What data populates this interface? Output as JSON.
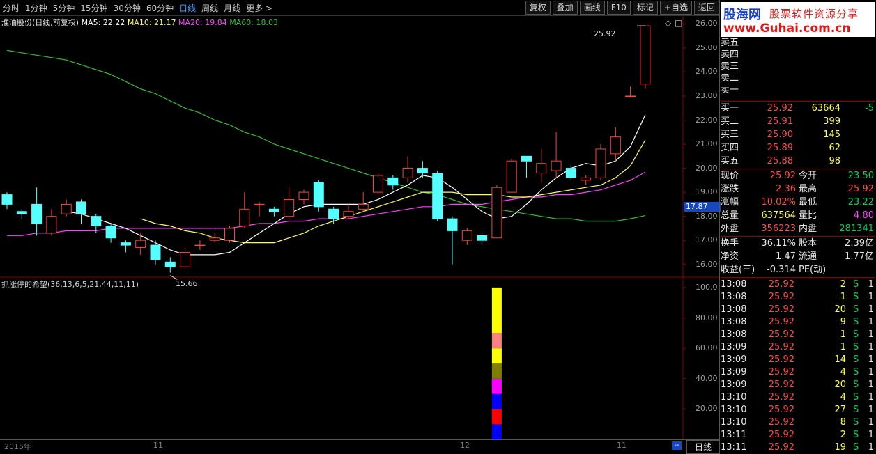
{
  "toolbar": {
    "periods": [
      "分时",
      "1分钟",
      "5分钟",
      "15分钟",
      "30分钟",
      "60分钟",
      "日线",
      "周线",
      "月线",
      "更多 >"
    ],
    "active_index": 6,
    "buttons": [
      "复权",
      "叠加",
      "画线",
      "F10",
      "标记",
      "+自选",
      "返回"
    ]
  },
  "logo": {
    "line1_a": "股海网",
    "line1_b": "股票软件资源分享",
    "line2": "www.Guhai.com.cn"
  },
  "legend": {
    "stock": "淮油股份(日线,前复权)",
    "ma5": "MA5: 22.22",
    "ma10": "MA10: 21.17",
    "ma20": "MA20: 19.84",
    "ma60": "MA60: 18.03"
  },
  "indicator": {
    "name": "抓涨停的希望(36,13,6,5,21,44,11,11)"
  },
  "price_axis": [
    "26.00",
    "25.00",
    "24.00",
    "23.00",
    "22.00",
    "21.00",
    "20.00",
    "19.00",
    "18.00",
    "17.00",
    "16.00"
  ],
  "price_cursor": "17.87",
  "ind_axis": [
    "100.0",
    "80.00",
    "60.00",
    "40.00",
    "20.00"
  ],
  "annotations": {
    "high": "25.92",
    "low": "15.66"
  },
  "time_axis": [
    "2015年",
    "11",
    "12",
    "11"
  ],
  "bottom_period": "日线",
  "colors": {
    "up": "#ff4040",
    "down": "#54ffff",
    "ma5": "#ffffff",
    "ma10": "#ffff50",
    "ma20": "#ff40ff",
    "ma60": "#30c030"
  },
  "chart_data": {
    "type": "candlestick",
    "ylim": [
      15.5,
      26.3
    ],
    "candles": [
      [
        18.9,
        18.5,
        19.0,
        18.3
      ],
      [
        18.2,
        18.1,
        18.3,
        17.9
      ],
      [
        18.5,
        17.7,
        19.2,
        17.2
      ],
      [
        17.3,
        18.0,
        18.3,
        17.2
      ],
      [
        18.1,
        18.5,
        18.7,
        18.0
      ],
      [
        18.6,
        18.1,
        18.7,
        17.7
      ],
      [
        18.0,
        17.6,
        18.1,
        17.3
      ],
      [
        17.6,
        17.1,
        17.7,
        16.9
      ],
      [
        16.9,
        16.8,
        17.0,
        16.5
      ],
      [
        16.7,
        17.0,
        17.3,
        16.4
      ],
      [
        16.8,
        16.2,
        17.0,
        16.0
      ],
      [
        16.1,
        15.9,
        16.3,
        15.66
      ],
      [
        15.9,
        16.5,
        16.7,
        15.8
      ],
      [
        16.8,
        16.8,
        17.0,
        16.6
      ],
      [
        17.0,
        17.1,
        17.3,
        16.9
      ],
      [
        17.0,
        17.5,
        17.6,
        16.9
      ],
      [
        17.6,
        18.3,
        19.0,
        17.5
      ],
      [
        18.5,
        18.5,
        18.6,
        18.0
      ],
      [
        18.3,
        18.2,
        18.4,
        18.0
      ],
      [
        18.0,
        18.7,
        19.2,
        17.9
      ],
      [
        18.7,
        19.0,
        19.1,
        18.5
      ],
      [
        19.4,
        18.4,
        19.5,
        18.2
      ],
      [
        18.3,
        17.9,
        18.4,
        17.7
      ],
      [
        18.0,
        18.2,
        18.5,
        17.9
      ],
      [
        18.3,
        18.5,
        19.0,
        18.2
      ],
      [
        19.0,
        19.7,
        19.8,
        18.9
      ],
      [
        19.6,
        19.3,
        19.7,
        19.1
      ],
      [
        19.6,
        20.0,
        20.5,
        19.4
      ],
      [
        20.0,
        19.8,
        20.3,
        19.6
      ],
      [
        19.8,
        17.9,
        19.9,
        17.8
      ],
      [
        17.9,
        17.4,
        18.0,
        16.0
      ],
      [
        17.0,
        17.4,
        17.5,
        16.8
      ],
      [
        17.2,
        17.0,
        17.3,
        16.8
      ],
      [
        17.1,
        19.2,
        19.3,
        17.1
      ],
      [
        19.0,
        20.3,
        20.4,
        19.0
      ],
      [
        20.5,
        20.3,
        20.5,
        19.6
      ],
      [
        19.8,
        20.2,
        20.8,
        19.4
      ],
      [
        19.9,
        20.3,
        21.5,
        19.6
      ],
      [
        20.0,
        19.6,
        20.2,
        19.5
      ],
      [
        19.5,
        19.6,
        19.7,
        19.3
      ],
      [
        19.6,
        20.8,
        21.0,
        19.5
      ],
      [
        20.6,
        21.3,
        21.7,
        20.3
      ],
      [
        23.0,
        23.0,
        23.4,
        23.0
      ],
      [
        23.5,
        25.92,
        25.92,
        23.3
      ]
    ],
    "ma5": [
      null,
      null,
      null,
      null,
      18.2,
      18.1,
      17.9,
      17.7,
      17.5,
      17.2,
      16.9,
      16.6,
      16.4,
      16.4,
      16.4,
      16.5,
      16.9,
      17.3,
      17.7,
      18.1,
      18.4,
      18.5,
      18.5,
      18.5,
      18.5,
      18.7,
      19.0,
      19.3,
      19.7,
      19.6,
      19.2,
      18.7,
      18.2,
      17.9,
      18.0,
      18.5,
      19.1,
      19.6,
      20.0,
      20.2,
      20.1,
      20.3,
      20.9,
      22.22
    ],
    "ma10": [
      null,
      null,
      null,
      null,
      null,
      null,
      null,
      null,
      null,
      17.9,
      17.7,
      17.6,
      17.4,
      17.3,
      17.1,
      17.0,
      16.9,
      16.9,
      16.9,
      17.1,
      17.3,
      17.6,
      17.8,
      18.0,
      18.2,
      18.4,
      18.6,
      18.8,
      19.0,
      19.0,
      19.0,
      18.9,
      18.9,
      18.9,
      18.8,
      18.8,
      18.9,
      19.0,
      19.1,
      19.2,
      19.3,
      19.6,
      20.1,
      21.17
    ],
    "ma20": [
      17.2,
      17.2,
      17.3,
      17.3,
      17.4,
      17.4,
      17.4,
      17.5,
      17.5,
      17.5,
      17.5,
      17.5,
      17.5,
      17.5,
      17.5,
      17.5,
      17.6,
      17.7,
      17.7,
      17.8,
      17.8,
      17.9,
      17.9,
      17.9,
      18.0,
      18.1,
      18.2,
      18.3,
      18.4,
      18.4,
      18.5,
      18.5,
      18.5,
      18.6,
      18.7,
      18.8,
      18.8,
      18.9,
      18.9,
      19.0,
      19.1,
      19.3,
      19.5,
      19.84
    ],
    "ma60": [
      24.9,
      24.8,
      24.7,
      24.6,
      24.5,
      24.3,
      24.1,
      23.9,
      23.6,
      23.3,
      23.1,
      22.8,
      22.5,
      22.3,
      22.0,
      21.8,
      21.5,
      21.3,
      21.0,
      20.8,
      20.6,
      20.4,
      20.2,
      20.0,
      19.8,
      19.6,
      19.4,
      19.2,
      19.0,
      18.9,
      18.7,
      18.5,
      18.4,
      18.3,
      18.2,
      18.1,
      18.0,
      17.9,
      17.9,
      17.8,
      17.8,
      17.8,
      17.9,
      18.03
    ],
    "indicator_ylim": [
      0,
      105
    ],
    "indicator_bar_index": 33,
    "indicator_segments": [
      {
        "from": 0,
        "to": 10,
        "color": "#0000ff"
      },
      {
        "from": 10,
        "to": 20,
        "color": "#ff0000"
      },
      {
        "from": 20,
        "to": 30,
        "color": "#0000ff"
      },
      {
        "from": 30,
        "to": 40,
        "color": "#ff00ff"
      },
      {
        "from": 40,
        "to": 50,
        "color": "#808000"
      },
      {
        "from": 50,
        "to": 60,
        "color": "#ffff00"
      },
      {
        "from": 60,
        "to": 70,
        "color": "#ff8080"
      },
      {
        "from": 70,
        "to": 100,
        "color": "#ffff00"
      }
    ]
  },
  "sell_levels": [
    "卖五",
    "卖四",
    "卖三",
    "卖二",
    "卖一"
  ],
  "buy_levels": [
    {
      "label": "买一",
      "price": "25.92",
      "vol": "63664",
      "chg": "-5"
    },
    {
      "label": "买二",
      "price": "25.91",
      "vol": "399",
      "chg": ""
    },
    {
      "label": "买三",
      "price": "25.90",
      "vol": "145",
      "chg": ""
    },
    {
      "label": "买四",
      "price": "25.89",
      "vol": "62",
      "chg": ""
    },
    {
      "label": "买五",
      "price": "25.88",
      "vol": "98",
      "chg": ""
    }
  ],
  "stats": [
    {
      "l1": "现价",
      "v1": "25.92",
      "l2": "今开",
      "v2": "23.50",
      "c1": "red",
      "c2": "grn"
    },
    {
      "l1": "涨跌",
      "v1": "2.36",
      "l2": "最高",
      "v2": "25.92",
      "c1": "red",
      "c2": "red"
    },
    {
      "l1": "涨幅",
      "v1": "10.02%",
      "l2": "最低",
      "v2": "23.22",
      "c1": "red",
      "c2": "grn"
    },
    {
      "l1": "总量",
      "v1": "637564",
      "l2": "量比",
      "v2": "4.80",
      "c1": "yel",
      "c2": "mag"
    },
    {
      "l1": "外盘",
      "v1": "356223",
      "l2": "内盘",
      "v2": "281341",
      "c1": "red",
      "c2": "grn"
    }
  ],
  "stats2": [
    {
      "l1": "换手",
      "v1": "36.11%",
      "l2": "股本",
      "v2": "2.39亿"
    },
    {
      "l1": "净资",
      "v1": "1.47",
      "l2": "流通",
      "v2": "1.77亿"
    },
    {
      "l1": "收益(三)",
      "v1": "-0.314",
      "l2": "PE(动)",
      "v2": ""
    }
  ],
  "ticks": [
    {
      "t": "13:08",
      "p": "25.92",
      "v": "2",
      "s": "S",
      "n": "1"
    },
    {
      "t": "13:08",
      "p": "25.92",
      "v": "1",
      "s": "S",
      "n": "1"
    },
    {
      "t": "13:08",
      "p": "25.92",
      "v": "20",
      "s": "S",
      "n": "1"
    },
    {
      "t": "13:08",
      "p": "25.92",
      "v": "9",
      "s": "S",
      "n": "1"
    },
    {
      "t": "13:08",
      "p": "25.92",
      "v": "1",
      "s": "S",
      "n": "1"
    },
    {
      "t": "13:09",
      "p": "25.92",
      "v": "1",
      "s": "S",
      "n": "1"
    },
    {
      "t": "13:09",
      "p": "25.92",
      "v": "14",
      "s": "S",
      "n": "1"
    },
    {
      "t": "13:09",
      "p": "25.92",
      "v": "4",
      "s": "S",
      "n": "1"
    },
    {
      "t": "13:09",
      "p": "25.92",
      "v": "20",
      "s": "S",
      "n": "1"
    },
    {
      "t": "13:10",
      "p": "25.92",
      "v": "4",
      "s": "S",
      "n": "1"
    },
    {
      "t": "13:10",
      "p": "25.92",
      "v": "27",
      "s": "S",
      "n": "1"
    },
    {
      "t": "13:10",
      "p": "25.92",
      "v": "8",
      "s": "S",
      "n": "1"
    },
    {
      "t": "13:11",
      "p": "25.92",
      "v": "2",
      "s": "S",
      "n": "1"
    },
    {
      "t": "13:11",
      "p": "25.92",
      "v": "19",
      "s": "S",
      "n": "1"
    }
  ]
}
